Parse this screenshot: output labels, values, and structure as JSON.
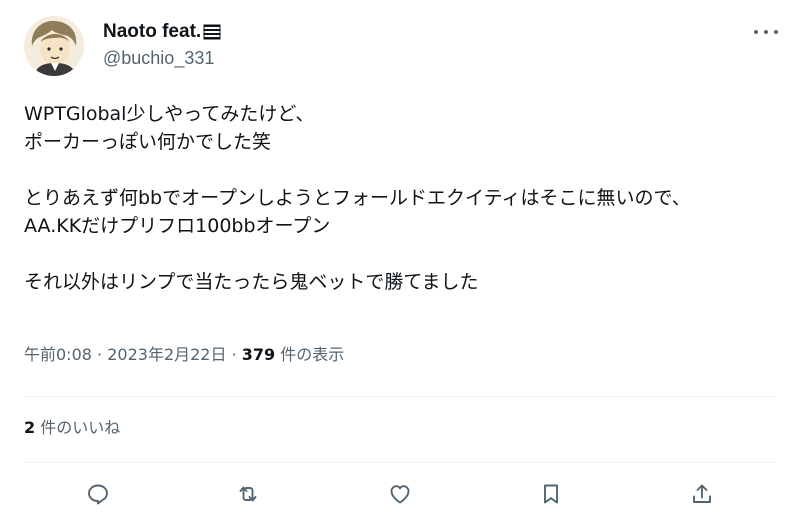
{
  "author": {
    "display_name": "Naoto feat.",
    "handle": "@buchio_331"
  },
  "tweet": {
    "text": "WPTGlobal少しやってみたけど、\nポーカーっぽい何かでした笑\n\nとりあえず何bbでオープンしようとフォールドエクイティはそこに無いので、\nAA.KKだけプリフロ100bbオープン\n\nそれ以外はリンプで当たったら鬼ベットで勝てました"
  },
  "meta": {
    "time": "午前0:08",
    "separator": "·",
    "date": "2023年2月22日",
    "views_count": "379",
    "views_label": "件の表示"
  },
  "likes": {
    "count": "2",
    "label": "件のいいね"
  },
  "icons": {
    "reply": "reply-icon",
    "retweet": "retweet-icon",
    "like": "like-icon",
    "bookmark": "bookmark-icon",
    "share": "share-icon",
    "more": "more-icon"
  },
  "colors": {
    "text": "#0f1419",
    "secondary": "#536471",
    "divider": "#eff3f4"
  }
}
